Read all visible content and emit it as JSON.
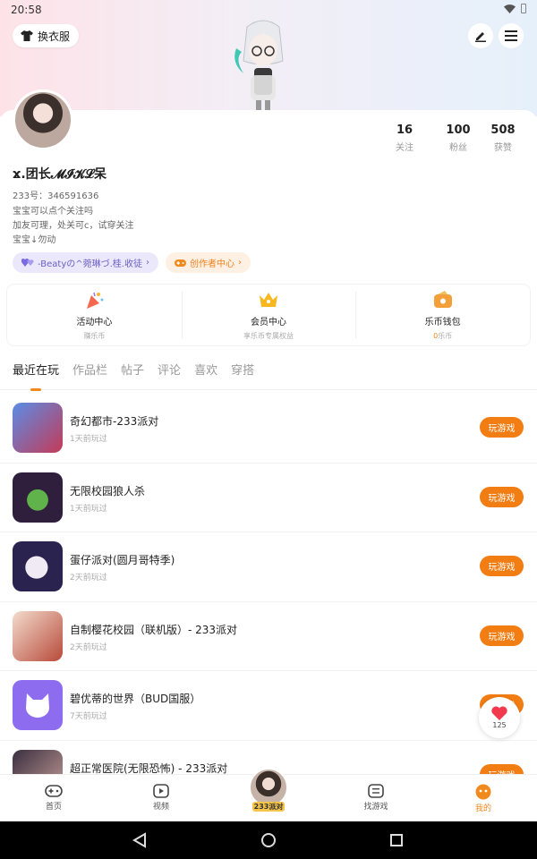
{
  "status": {
    "time": "20:58"
  },
  "header": {
    "outfit_label": "换衣服"
  },
  "profile": {
    "stats": [
      {
        "num": "16",
        "label": "关注"
      },
      {
        "num": "100",
        "label": "粉丝"
      },
      {
        "num": "508",
        "label": "获赞"
      }
    ],
    "name": "ϫ.团长𝓜𝓘𝓚𝓛呆",
    "uid": "233号：346591636",
    "bio": [
      "宝宝可以点个关注吗",
      "加友可理，处关可c，试穿关注",
      "宝宝↓勿动"
    ],
    "tags": [
      {
        "label": "-Beatyの^菀琳づ.桂.收徒"
      },
      {
        "label": "创作者中心"
      }
    ]
  },
  "quick": [
    {
      "title": "活动中心",
      "sub": "赚乐币"
    },
    {
      "title": "会员中心",
      "sub": "享乐币专属权益"
    },
    {
      "title": "乐币钱包",
      "sub_num": "0",
      "sub": "乐币"
    }
  ],
  "tabs": [
    "最近在玩",
    "作品栏",
    "帖子",
    "评论",
    "喜欢",
    "穿搭"
  ],
  "games": [
    {
      "title": "奇幻都市-233派对",
      "time": "1天前玩过",
      "btn": "玩游戏",
      "color": "#4a7fd6"
    },
    {
      "title": "无限校园狼人杀",
      "time": "1天前玩过",
      "btn": "玩游戏",
      "color": "#3d2c4a"
    },
    {
      "title": "蛋仔派对(圆月哥特季)",
      "time": "2天前玩过",
      "btn": "玩游戏",
      "color": "#2a2350"
    },
    {
      "title": "自制樱花校园（联机版）- 233派对",
      "time": "2天前玩过",
      "btn": "玩游戏",
      "color": "#e9c7b5"
    },
    {
      "title": "碧优蒂的世界（BUD国服）",
      "time": "7天前玩过",
      "btn": "玩游戏",
      "color": "#8e6cf0"
    },
    {
      "title": "超正常医院(无限恐怖) - 233派对",
      "time": "",
      "btn": "玩游戏",
      "color": "#2b2a3a"
    }
  ],
  "like": {
    "count": "125"
  },
  "nav": [
    {
      "label": "首页",
      "icon": "gamepad-icon"
    },
    {
      "label": "视频",
      "icon": "play-icon"
    },
    {
      "label": "233派对",
      "icon": "party-avatar"
    },
    {
      "label": "找游戏",
      "icon": "list-icon"
    },
    {
      "label": "我的",
      "icon": "face-icon"
    }
  ],
  "accent": "#f27d13"
}
